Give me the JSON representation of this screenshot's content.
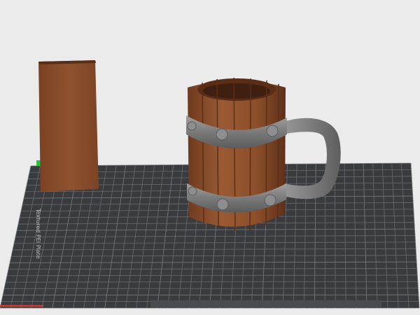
{
  "viewport": {
    "background": "#ebebeb",
    "bed_label": "Textured PEI Plate",
    "bed_color": "#3a3b3e",
    "grid_color": "#6c6d70",
    "wipe_tower_color": "#8a4d2a",
    "mug_wood_color": "#8c4f2a",
    "mug_band_color": "#7d7d7d",
    "handle_color": "#7a7a7a",
    "axis_x_color": "#d23a2a",
    "axis_y_color": "#2fbf3f"
  }
}
